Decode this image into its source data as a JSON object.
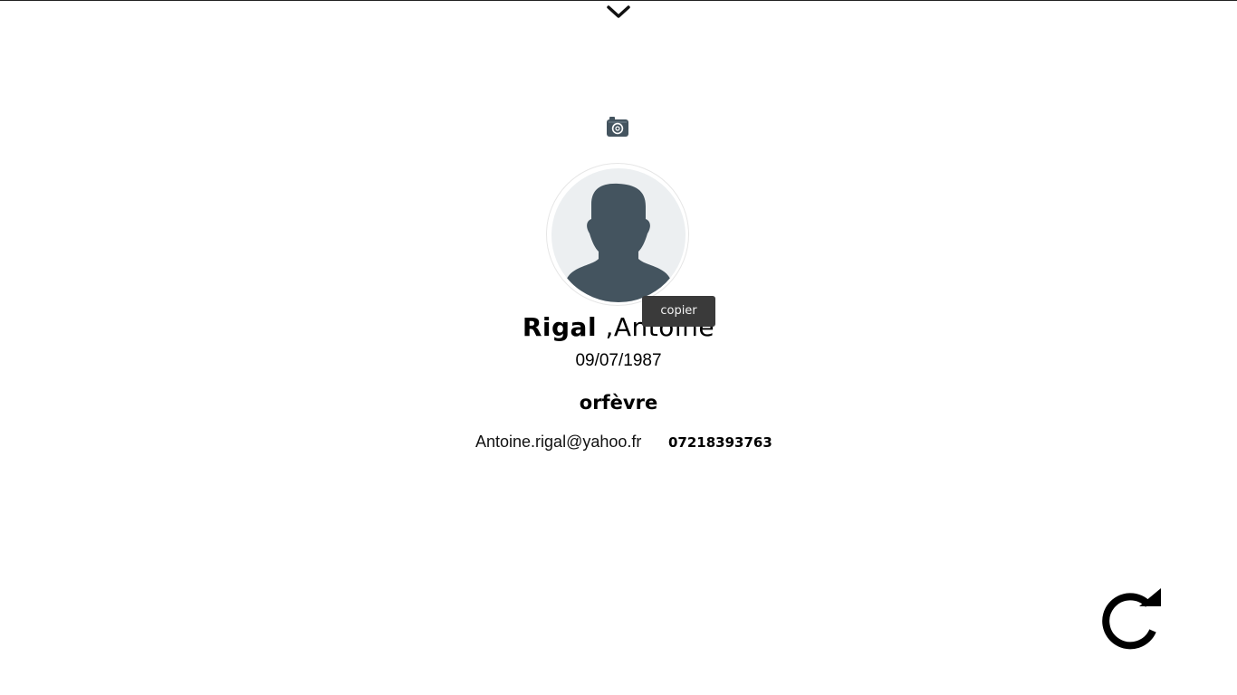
{
  "profile": {
    "last_name": "Rigal",
    "separator": " ,",
    "first_name": "Antoine",
    "birth_date": "09/07/1987",
    "job_title": "orfèvre",
    "email": "Antoine.rigal@yahoo.fr",
    "phone": "07218393763"
  },
  "tooltip": {
    "label": "copier"
  },
  "icons": {
    "top": "chevron-down-icon",
    "photo": "camera-icon",
    "avatar": "user-silhouette-icon",
    "reload": "refresh-icon"
  },
  "colors": {
    "icon_slate": "#44545f",
    "avatar_bg": "#eceff1",
    "tooltip_bg": "#3a3a3a",
    "text": "#000000"
  }
}
